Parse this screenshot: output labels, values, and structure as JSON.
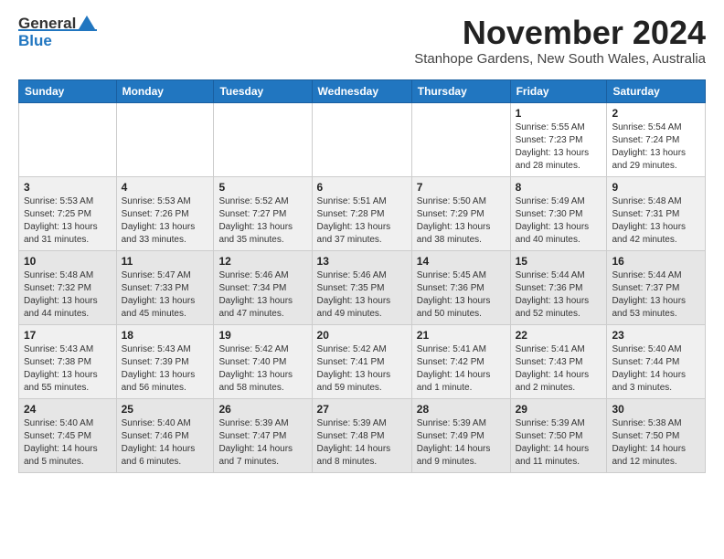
{
  "header": {
    "logo_line1": "General",
    "logo_line2": "Blue",
    "month_title": "November 2024",
    "subtitle": "Stanhope Gardens, New South Wales, Australia"
  },
  "weekdays": [
    "Sunday",
    "Monday",
    "Tuesday",
    "Wednesday",
    "Thursday",
    "Friday",
    "Saturday"
  ],
  "weeks": [
    [
      {
        "day": "",
        "info": ""
      },
      {
        "day": "",
        "info": ""
      },
      {
        "day": "",
        "info": ""
      },
      {
        "day": "",
        "info": ""
      },
      {
        "day": "",
        "info": ""
      },
      {
        "day": "1",
        "info": "Sunrise: 5:55 AM\nSunset: 7:23 PM\nDaylight: 13 hours\nand 28 minutes."
      },
      {
        "day": "2",
        "info": "Sunrise: 5:54 AM\nSunset: 7:24 PM\nDaylight: 13 hours\nand 29 minutes."
      }
    ],
    [
      {
        "day": "3",
        "info": "Sunrise: 5:53 AM\nSunset: 7:25 PM\nDaylight: 13 hours\nand 31 minutes."
      },
      {
        "day": "4",
        "info": "Sunrise: 5:53 AM\nSunset: 7:26 PM\nDaylight: 13 hours\nand 33 minutes."
      },
      {
        "day": "5",
        "info": "Sunrise: 5:52 AM\nSunset: 7:27 PM\nDaylight: 13 hours\nand 35 minutes."
      },
      {
        "day": "6",
        "info": "Sunrise: 5:51 AM\nSunset: 7:28 PM\nDaylight: 13 hours\nand 37 minutes."
      },
      {
        "day": "7",
        "info": "Sunrise: 5:50 AM\nSunset: 7:29 PM\nDaylight: 13 hours\nand 38 minutes."
      },
      {
        "day": "8",
        "info": "Sunrise: 5:49 AM\nSunset: 7:30 PM\nDaylight: 13 hours\nand 40 minutes."
      },
      {
        "day": "9",
        "info": "Sunrise: 5:48 AM\nSunset: 7:31 PM\nDaylight: 13 hours\nand 42 minutes."
      }
    ],
    [
      {
        "day": "10",
        "info": "Sunrise: 5:48 AM\nSunset: 7:32 PM\nDaylight: 13 hours\nand 44 minutes."
      },
      {
        "day": "11",
        "info": "Sunrise: 5:47 AM\nSunset: 7:33 PM\nDaylight: 13 hours\nand 45 minutes."
      },
      {
        "day": "12",
        "info": "Sunrise: 5:46 AM\nSunset: 7:34 PM\nDaylight: 13 hours\nand 47 minutes."
      },
      {
        "day": "13",
        "info": "Sunrise: 5:46 AM\nSunset: 7:35 PM\nDaylight: 13 hours\nand 49 minutes."
      },
      {
        "day": "14",
        "info": "Sunrise: 5:45 AM\nSunset: 7:36 PM\nDaylight: 13 hours\nand 50 minutes."
      },
      {
        "day": "15",
        "info": "Sunrise: 5:44 AM\nSunset: 7:36 PM\nDaylight: 13 hours\nand 52 minutes."
      },
      {
        "day": "16",
        "info": "Sunrise: 5:44 AM\nSunset: 7:37 PM\nDaylight: 13 hours\nand 53 minutes."
      }
    ],
    [
      {
        "day": "17",
        "info": "Sunrise: 5:43 AM\nSunset: 7:38 PM\nDaylight: 13 hours\nand 55 minutes."
      },
      {
        "day": "18",
        "info": "Sunrise: 5:43 AM\nSunset: 7:39 PM\nDaylight: 13 hours\nand 56 minutes."
      },
      {
        "day": "19",
        "info": "Sunrise: 5:42 AM\nSunset: 7:40 PM\nDaylight: 13 hours\nand 58 minutes."
      },
      {
        "day": "20",
        "info": "Sunrise: 5:42 AM\nSunset: 7:41 PM\nDaylight: 13 hours\nand 59 minutes."
      },
      {
        "day": "21",
        "info": "Sunrise: 5:41 AM\nSunset: 7:42 PM\nDaylight: 14 hours\nand 1 minute."
      },
      {
        "day": "22",
        "info": "Sunrise: 5:41 AM\nSunset: 7:43 PM\nDaylight: 14 hours\nand 2 minutes."
      },
      {
        "day": "23",
        "info": "Sunrise: 5:40 AM\nSunset: 7:44 PM\nDaylight: 14 hours\nand 3 minutes."
      }
    ],
    [
      {
        "day": "24",
        "info": "Sunrise: 5:40 AM\nSunset: 7:45 PM\nDaylight: 14 hours\nand 5 minutes."
      },
      {
        "day": "25",
        "info": "Sunrise: 5:40 AM\nSunset: 7:46 PM\nDaylight: 14 hours\nand 6 minutes."
      },
      {
        "day": "26",
        "info": "Sunrise: 5:39 AM\nSunset: 7:47 PM\nDaylight: 14 hours\nand 7 minutes."
      },
      {
        "day": "27",
        "info": "Sunrise: 5:39 AM\nSunset: 7:48 PM\nDaylight: 14 hours\nand 8 minutes."
      },
      {
        "day": "28",
        "info": "Sunrise: 5:39 AM\nSunset: 7:49 PM\nDaylight: 14 hours\nand 9 minutes."
      },
      {
        "day": "29",
        "info": "Sunrise: 5:39 AM\nSunset: 7:50 PM\nDaylight: 14 hours\nand 11 minutes."
      },
      {
        "day": "30",
        "info": "Sunrise: 5:38 AM\nSunset: 7:50 PM\nDaylight: 14 hours\nand 12 minutes."
      }
    ]
  ]
}
